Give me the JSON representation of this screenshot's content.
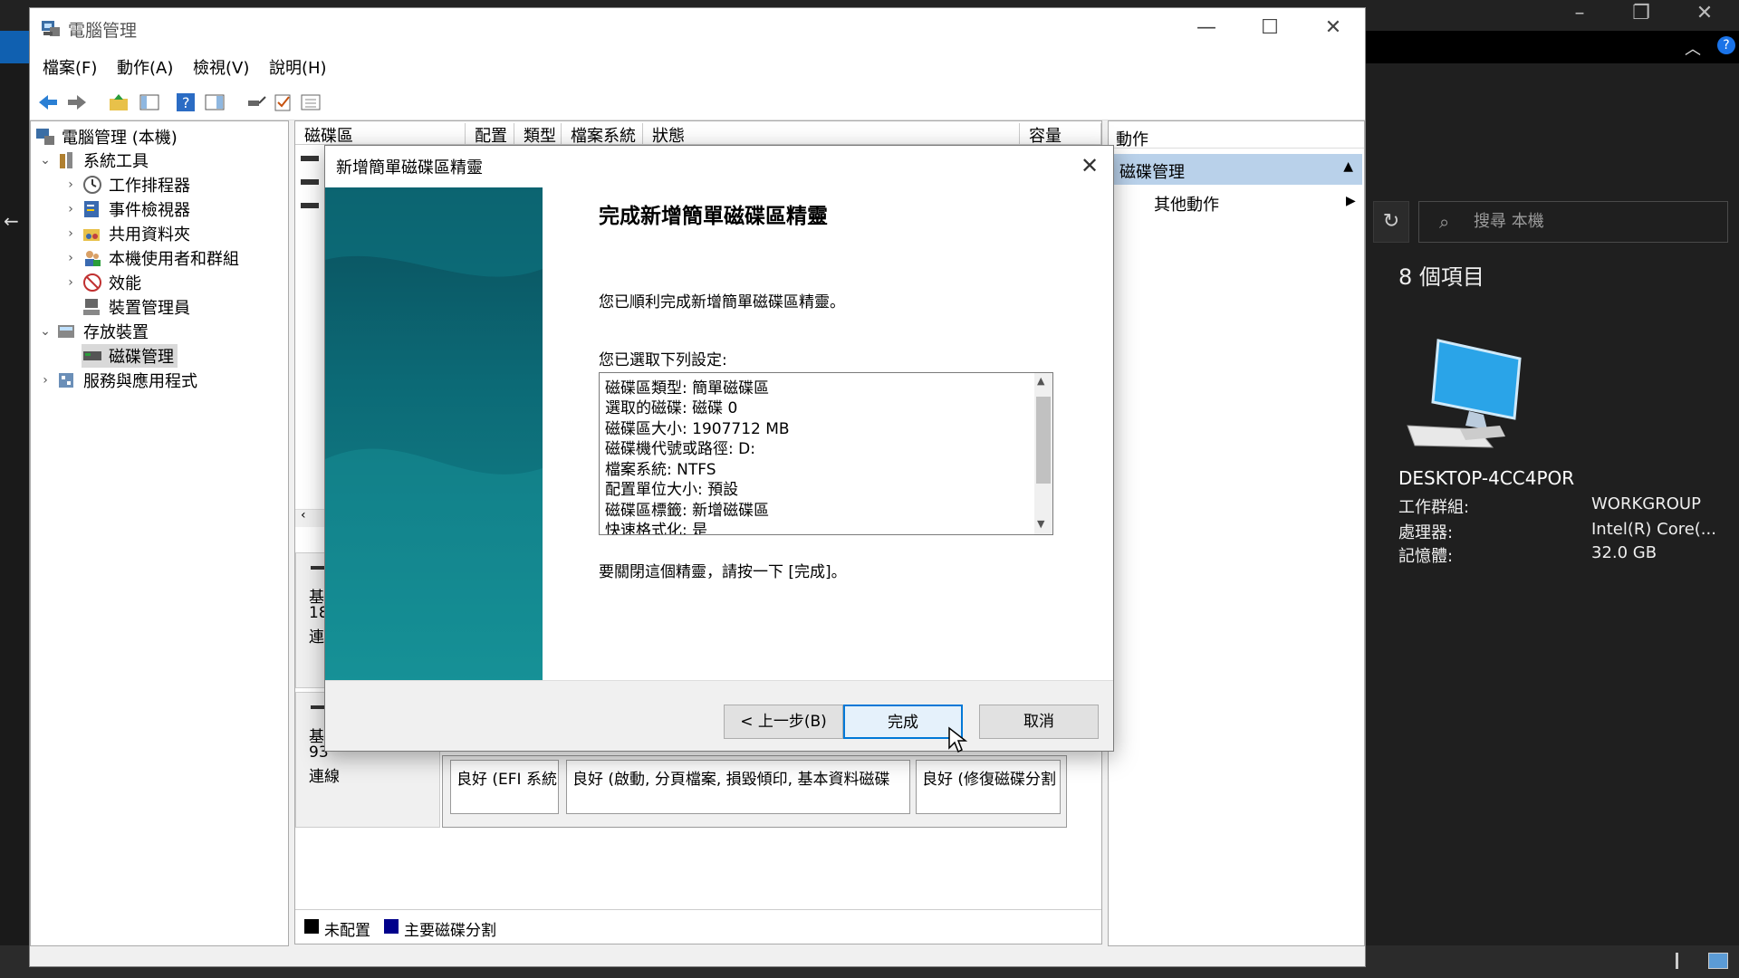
{
  "background_explorer": {
    "search_placeholder": "搜尋 本機",
    "item_count": "8 個項目",
    "pc_name": "DESKTOP-4CC4POR",
    "specs": [
      {
        "key": "工作群組:",
        "value": "WORKGROUP"
      },
      {
        "key": "處理器:",
        "value": "Intel(R) Core(..."
      },
      {
        "key": "記憶體:",
        "value": "32.0 GB"
      }
    ]
  },
  "window": {
    "title": "電腦管理",
    "menu": [
      "檔案(F)",
      "動作(A)",
      "檢視(V)",
      "說明(H)"
    ]
  },
  "tree": [
    {
      "label": "電腦管理 (本機)",
      "level": 0,
      "arrow": ""
    },
    {
      "label": "系統工具",
      "level": 1,
      "arrow": "⌄"
    },
    {
      "label": "工作排程器",
      "level": 2,
      "arrow": "›"
    },
    {
      "label": "事件檢視器",
      "level": 2,
      "arrow": "›"
    },
    {
      "label": "共用資料夾",
      "level": 2,
      "arrow": "›"
    },
    {
      "label": "本機使用者和群組",
      "level": 2,
      "arrow": "›"
    },
    {
      "label": "效能",
      "level": 2,
      "arrow": "›"
    },
    {
      "label": "裝置管理員",
      "level": 2,
      "arrow": ""
    },
    {
      "label": "存放裝置",
      "level": 1,
      "arrow": "⌄"
    },
    {
      "label": "磁碟管理",
      "level": 2,
      "arrow": "",
      "selected": true
    },
    {
      "label": "服務與應用程式",
      "level": 1,
      "arrow": "›"
    }
  ],
  "columns": [
    "磁碟區",
    "配置",
    "類型",
    "檔案系統",
    "狀態",
    "容量"
  ],
  "disk_rows": {
    "disk0": [
      "基",
      "18",
      "連"
    ],
    "disk1": [
      "基",
      "93",
      "連線"
    ],
    "volumes": [
      "良好 (EFI 系統",
      "良好 (啟動, 分頁檔案, 損毀傾印, 基本資料磁碟",
      "良好 (修復磁碟分割"
    ]
  },
  "legend": [
    "未配置",
    "主要磁碟分割"
  ],
  "actions": {
    "title": "動作",
    "group": "磁碟管理",
    "more": "其他動作"
  },
  "wizard": {
    "title": "新增簡單磁碟區精靈",
    "heading": "完成新增簡單磁碟區精靈",
    "msg1": "您已順利完成新增簡單磁碟區精靈。",
    "msg2": "您已選取下列設定:",
    "settings": [
      "磁碟區類型: 簡單磁碟區",
      "選取的磁碟: 磁碟 0",
      "磁碟區大小: 1907712 MB",
      "磁碟機代號或路徑: D:",
      "檔案系統: NTFS",
      "配置單位大小: 預設",
      "磁碟區標籤: 新增磁碟區",
      "快速格式化: 是"
    ],
    "close_msg": "要關閉這個精靈，請按一下 [完成]。",
    "back_label": "< 上一步(B)",
    "finish_label": "完成",
    "cancel_label": "取消"
  },
  "colors": {
    "accent": "#0078d7",
    "banner": "#0c6a76",
    "selection": "#b9d1ea"
  }
}
